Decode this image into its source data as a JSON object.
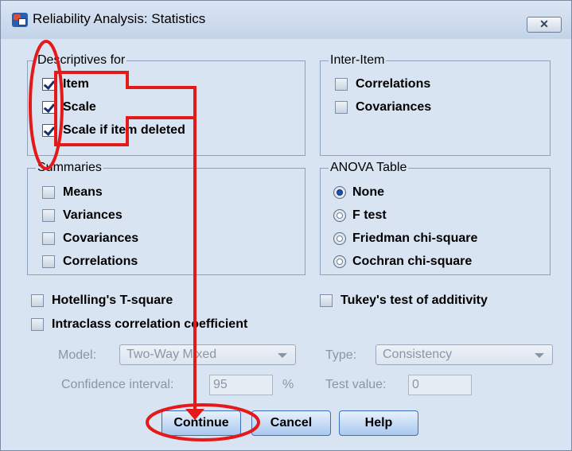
{
  "window": {
    "title": "Reliability Analysis: Statistics",
    "close_label": "✕",
    "app_icon": "spss-app-icon"
  },
  "descriptives": {
    "title": "Descriptives for",
    "items": [
      {
        "label": "Item",
        "checked": true
      },
      {
        "label": "Scale",
        "checked": true
      },
      {
        "label": "Scale if item deleted",
        "checked": true
      }
    ]
  },
  "inter_item": {
    "title": "Inter-Item",
    "items": [
      {
        "label": "Correlations",
        "checked": false
      },
      {
        "label": "Covariances",
        "checked": false
      }
    ]
  },
  "summaries": {
    "title": "Summaries",
    "items": [
      {
        "label": "Means",
        "checked": false
      },
      {
        "label": "Variances",
        "checked": false
      },
      {
        "label": "Covariances",
        "checked": false
      },
      {
        "label": "Correlations",
        "checked": false
      }
    ]
  },
  "anova": {
    "title": "ANOVA Table",
    "options": [
      {
        "label": "None",
        "selected": true
      },
      {
        "label": "F test",
        "selected": false
      },
      {
        "label": "Friedman chi-square",
        "selected": false
      },
      {
        "label": "Cochran chi-square",
        "selected": false
      }
    ]
  },
  "extras": {
    "hotelling": {
      "label": "Hotelling's T-square",
      "checked": false
    },
    "tukey": {
      "label": "Tukey's test of additivity",
      "checked": false
    },
    "intraclass": {
      "label": "Intraclass correlation coefficient",
      "checked": false
    }
  },
  "model": {
    "label": "Model:",
    "value": "Two-Way Mixed"
  },
  "type": {
    "label": "Type:",
    "value": "Consistency"
  },
  "confidence": {
    "label": "Confidence interval:",
    "value": "95",
    "unit": "%"
  },
  "test_value": {
    "label": "Test value:",
    "value": "0"
  },
  "buttons": {
    "continue": "Continue",
    "cancel": "Cancel",
    "help": "Help"
  },
  "annotation_color": "#e41a1a"
}
